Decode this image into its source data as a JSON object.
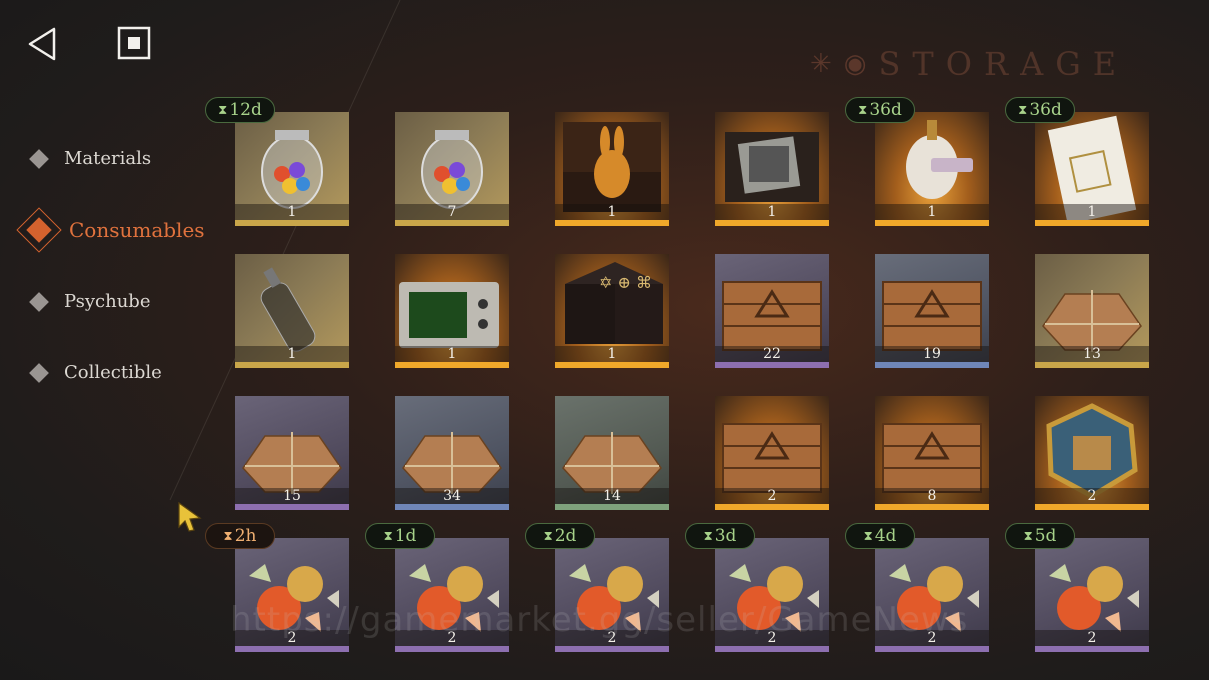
{
  "topbar": {
    "back_icon": "back-triangle-icon",
    "home_icon": "square-stop-icon"
  },
  "title": {
    "text": "STORAGE"
  },
  "sidebar": {
    "items": [
      {
        "label": "Materials",
        "active": false
      },
      {
        "label": "Consumables",
        "active": true
      },
      {
        "label": "Psychube",
        "active": false
      },
      {
        "label": "Collectible",
        "active": false
      }
    ]
  },
  "grid": {
    "items": [
      {
        "qty": "1",
        "rarity": "gold",
        "icon": "candy-jar-icon",
        "timer": "12d"
      },
      {
        "qty": "7",
        "rarity": "gold",
        "icon": "candy-jar-icon",
        "timer": ""
      },
      {
        "qty": "1",
        "rarity": "orange",
        "icon": "rabbit-box-icon",
        "timer": ""
      },
      {
        "qty": "1",
        "rarity": "orange",
        "icon": "photo-box-icon",
        "timer": ""
      },
      {
        "qty": "1",
        "rarity": "orange",
        "icon": "mannequin-sale-icon",
        "timer": "36d"
      },
      {
        "qty": "1",
        "rarity": "orange",
        "icon": "shopping-list-ticket-icon",
        "timer": "36d"
      },
      {
        "qty": "1",
        "rarity": "gold",
        "icon": "message-bottle-icon",
        "timer": ""
      },
      {
        "qty": "1",
        "rarity": "orange",
        "icon": "green-tv-icon",
        "timer": ""
      },
      {
        "qty": "1",
        "rarity": "orange",
        "icon": "rune-table-icon",
        "timer": ""
      },
      {
        "qty": "22",
        "rarity": "purple",
        "icon": "wooden-crate-icon",
        "timer": ""
      },
      {
        "qty": "19",
        "rarity": "blue",
        "icon": "wooden-crate-icon",
        "timer": ""
      },
      {
        "qty": "13",
        "rarity": "gold",
        "icon": "parcel-icon",
        "timer": ""
      },
      {
        "qty": "15",
        "rarity": "purple",
        "icon": "parcel-icon",
        "timer": ""
      },
      {
        "qty": "34",
        "rarity": "blue",
        "icon": "parcel-icon",
        "timer": ""
      },
      {
        "qty": "14",
        "rarity": "green",
        "icon": "parcel-icon",
        "timer": ""
      },
      {
        "qty": "2",
        "rarity": "orange",
        "icon": "wooden-crate-icon",
        "timer": ""
      },
      {
        "qty": "8",
        "rarity": "orange",
        "icon": "wooden-crate-icon",
        "timer": ""
      },
      {
        "qty": "2",
        "rarity": "orange",
        "icon": "stained-glass-medal-icon",
        "timer": ""
      },
      {
        "qty": "2",
        "rarity": "purple",
        "icon": "candy-icon",
        "timer": "2h",
        "timer_color": "orange"
      },
      {
        "qty": "2",
        "rarity": "purple",
        "icon": "candy-icon",
        "timer": "1d"
      },
      {
        "qty": "2",
        "rarity": "purple",
        "icon": "candy-icon",
        "timer": "2d"
      },
      {
        "qty": "2",
        "rarity": "purple",
        "icon": "candy-icon",
        "timer": "3d"
      },
      {
        "qty": "2",
        "rarity": "purple",
        "icon": "candy-icon",
        "timer": "4d"
      },
      {
        "qty": "2",
        "rarity": "purple",
        "icon": "candy-icon",
        "timer": "5d"
      }
    ]
  },
  "watermark": {
    "text": "https://gamemarket.gg/seller/GameNews"
  },
  "colors": {
    "accent": "#d4622e",
    "timer_green": "#a7d28a",
    "timer_orange": "#f0b072"
  }
}
